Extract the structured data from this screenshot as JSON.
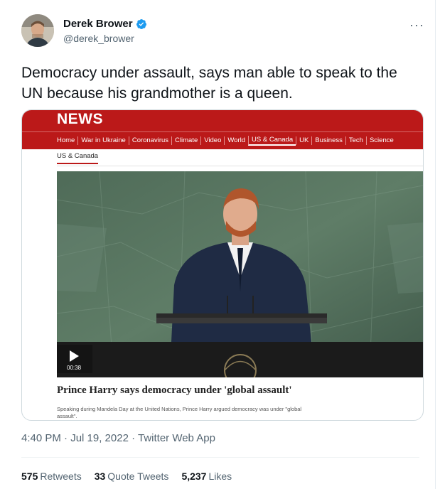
{
  "author": {
    "name": "Derek Brower",
    "handle": "@derek_brower",
    "verified": true
  },
  "more_menu": "···",
  "tweet": {
    "text": "Democracy under assault, says man able to speak to the UN because his grandmother is a queen."
  },
  "card": {
    "brand": "NEWS",
    "nav": [
      "Home",
      "War in Ukraine",
      "Coronavirus",
      "Climate",
      "Video",
      "World",
      "US & Canada",
      "UK",
      "Business",
      "Tech",
      "Science"
    ],
    "nav_active": "US & Canada",
    "sub_nav": "US & Canada",
    "video_duration": "00:38",
    "headline": "Prince Harry says democracy under 'global assault'",
    "summary": "Speaking during Mandela Day at the United Nations, Prince Harry argued democracy was under \"global assault\"."
  },
  "meta": {
    "timestamp": "4:40 PM · Jul 19, 2022 · Twitter Web App"
  },
  "stats": [
    {
      "count": "575",
      "label": "Retweets"
    },
    {
      "count": "33",
      "label": "Quote Tweets"
    },
    {
      "count": "5,237",
      "label": "Likes"
    }
  ],
  "colors": {
    "bbc_red": "#bb1919",
    "twitter_blue": "#1d9bf0",
    "secondary_text": "#536471"
  }
}
